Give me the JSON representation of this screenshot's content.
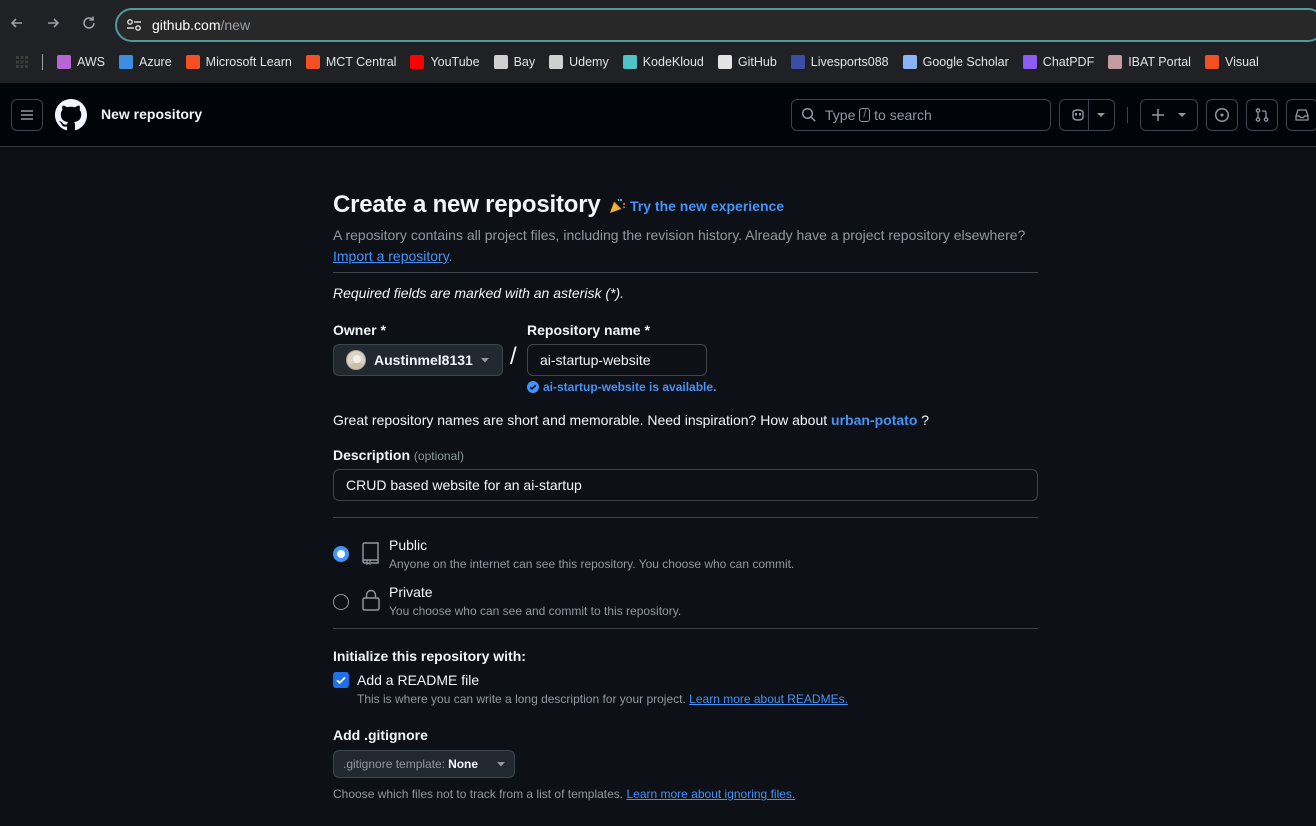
{
  "browser": {
    "url_host": "github.com",
    "url_path": "/new",
    "bookmarks": [
      {
        "label": "AWS",
        "color": "#b865d6"
      },
      {
        "label": "Azure",
        "color": "#3c8fe0"
      },
      {
        "label": "Microsoft Learn",
        "color": "#f25022"
      },
      {
        "label": "MCT Central",
        "color": "#f25022"
      },
      {
        "label": "YouTube",
        "color": "#ff0000"
      },
      {
        "label": "Bay",
        "color": "#cfcfcf"
      },
      {
        "label": "Udemy",
        "color": "#cfcfcf"
      },
      {
        "label": "KodeKloud",
        "color": "#4fc3c7"
      },
      {
        "label": "GitHub",
        "color": "#e3e3e3"
      },
      {
        "label": "Livesports088",
        "color": "#3a4ea8"
      },
      {
        "label": "Google Scholar",
        "color": "#8ab4f8"
      },
      {
        "label": "ChatPDF",
        "color": "#8b5cf6"
      },
      {
        "label": "IBAT Portal",
        "color": "#c49ca0"
      },
      {
        "label": "Visual",
        "color": "#f25022"
      }
    ]
  },
  "header": {
    "title": "New repository",
    "search_prefix": "Type",
    "search_key": "/",
    "search_suffix": "to search"
  },
  "form": {
    "heading": "Create a new repository",
    "try_new": "Try the new experience",
    "lead_text": "A repository contains all project files, including the revision history. Already have a project repository elsewhere?",
    "import_link": "Import a repository",
    "lead_end": ".",
    "required_note": "Required fields are marked with an asterisk (*).",
    "owner_label": "Owner *",
    "owner_value": "Austinmel8131",
    "repo_label": "Repository name *",
    "repo_value": "ai-startup-website",
    "available_text": "ai-startup-website is available.",
    "inspiration_text": "Great repository names are short and memorable. Need inspiration? How about",
    "inspiration_suggestion": "urban-potato",
    "inspiration_end": "?",
    "description_label": "Description",
    "description_optional": "(optional)",
    "description_value": "CRUD based website for an ai-startup",
    "public_title": "Public",
    "public_sub": "Anyone on the internet can see this repository. You choose who can commit.",
    "private_title": "Private",
    "private_sub": "You choose who can see and commit to this repository.",
    "visibility_selected": "Public",
    "init_label": "Initialize this repository with:",
    "readme_label": "Add a README file",
    "readme_checked": true,
    "readme_sub": "This is where you can write a long description for your project.",
    "readme_link": "Learn more about READMEs.",
    "gitignore_label": "Add .gitignore",
    "gitignore_prefix": ".gitignore template:",
    "gitignore_value": "None",
    "gitignore_sub": "Choose which files not to track from a list of templates.",
    "gitignore_link": "Learn more about ignoring files."
  }
}
